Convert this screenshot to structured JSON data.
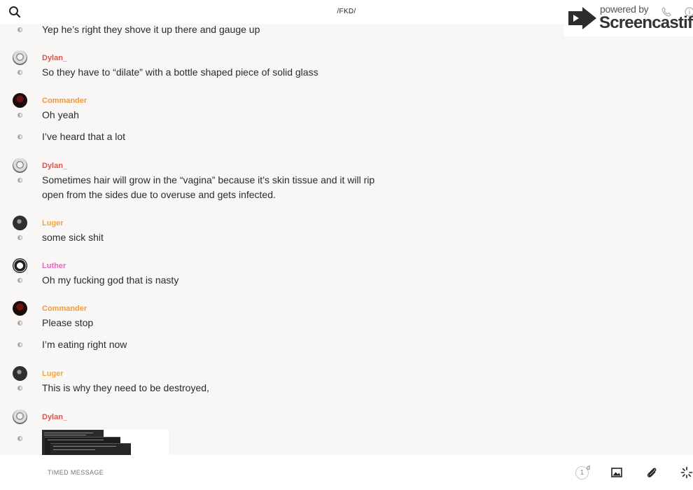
{
  "header": {
    "channel_title": "/FKD/"
  },
  "watermark": {
    "powered_by": "powered by",
    "brand": "Screencastify"
  },
  "messages": [
    {
      "author": "",
      "avatar": "",
      "texts": [
        "Yep he’s right they shove it up there and gauge up"
      ]
    },
    {
      "author": "Dylan_",
      "avatar": "robot",
      "texts": [
        "So they have to “dilate” with a bottle shaped piece of solid glass"
      ]
    },
    {
      "author": "Commander",
      "avatar": "red",
      "texts": [
        "Oh yeah",
        "I’ve heard that a lot"
      ]
    },
    {
      "author": "Dylan_",
      "avatar": "robot",
      "texts": [
        "Sometimes hair will grow in the “vagina” because it’s skin tissue and it will rip open from the sides due to overuse and gets infected."
      ]
    },
    {
      "author": "Luger",
      "avatar": "dark",
      "texts": [
        "some sick shit"
      ]
    },
    {
      "author": "Luther",
      "avatar": "ring",
      "texts": [
        "Oh my fucking god that is nasty"
      ]
    },
    {
      "author": "Commander",
      "avatar": "red",
      "texts": [
        "Please stop",
        "I’m eating right now"
      ]
    },
    {
      "author": "Luger",
      "avatar": "dark",
      "texts": [
        "This is why they need to be destroyed,"
      ]
    },
    {
      "author": "Dylan_",
      "avatar": "robot",
      "texts": []
    }
  ],
  "composer": {
    "placeholder": "TIMED MESSAGE",
    "timer_value": "1",
    "timer_unit": "d"
  },
  "icons": {
    "search": "search-icon",
    "image": "image-icon",
    "attach": "paperclip-icon",
    "effects": "sparkle-icon"
  },
  "colors": {
    "dylan": "#e0524c",
    "commander": "#f29a38",
    "luger": "#f2a640",
    "luther": "#e666bf"
  }
}
